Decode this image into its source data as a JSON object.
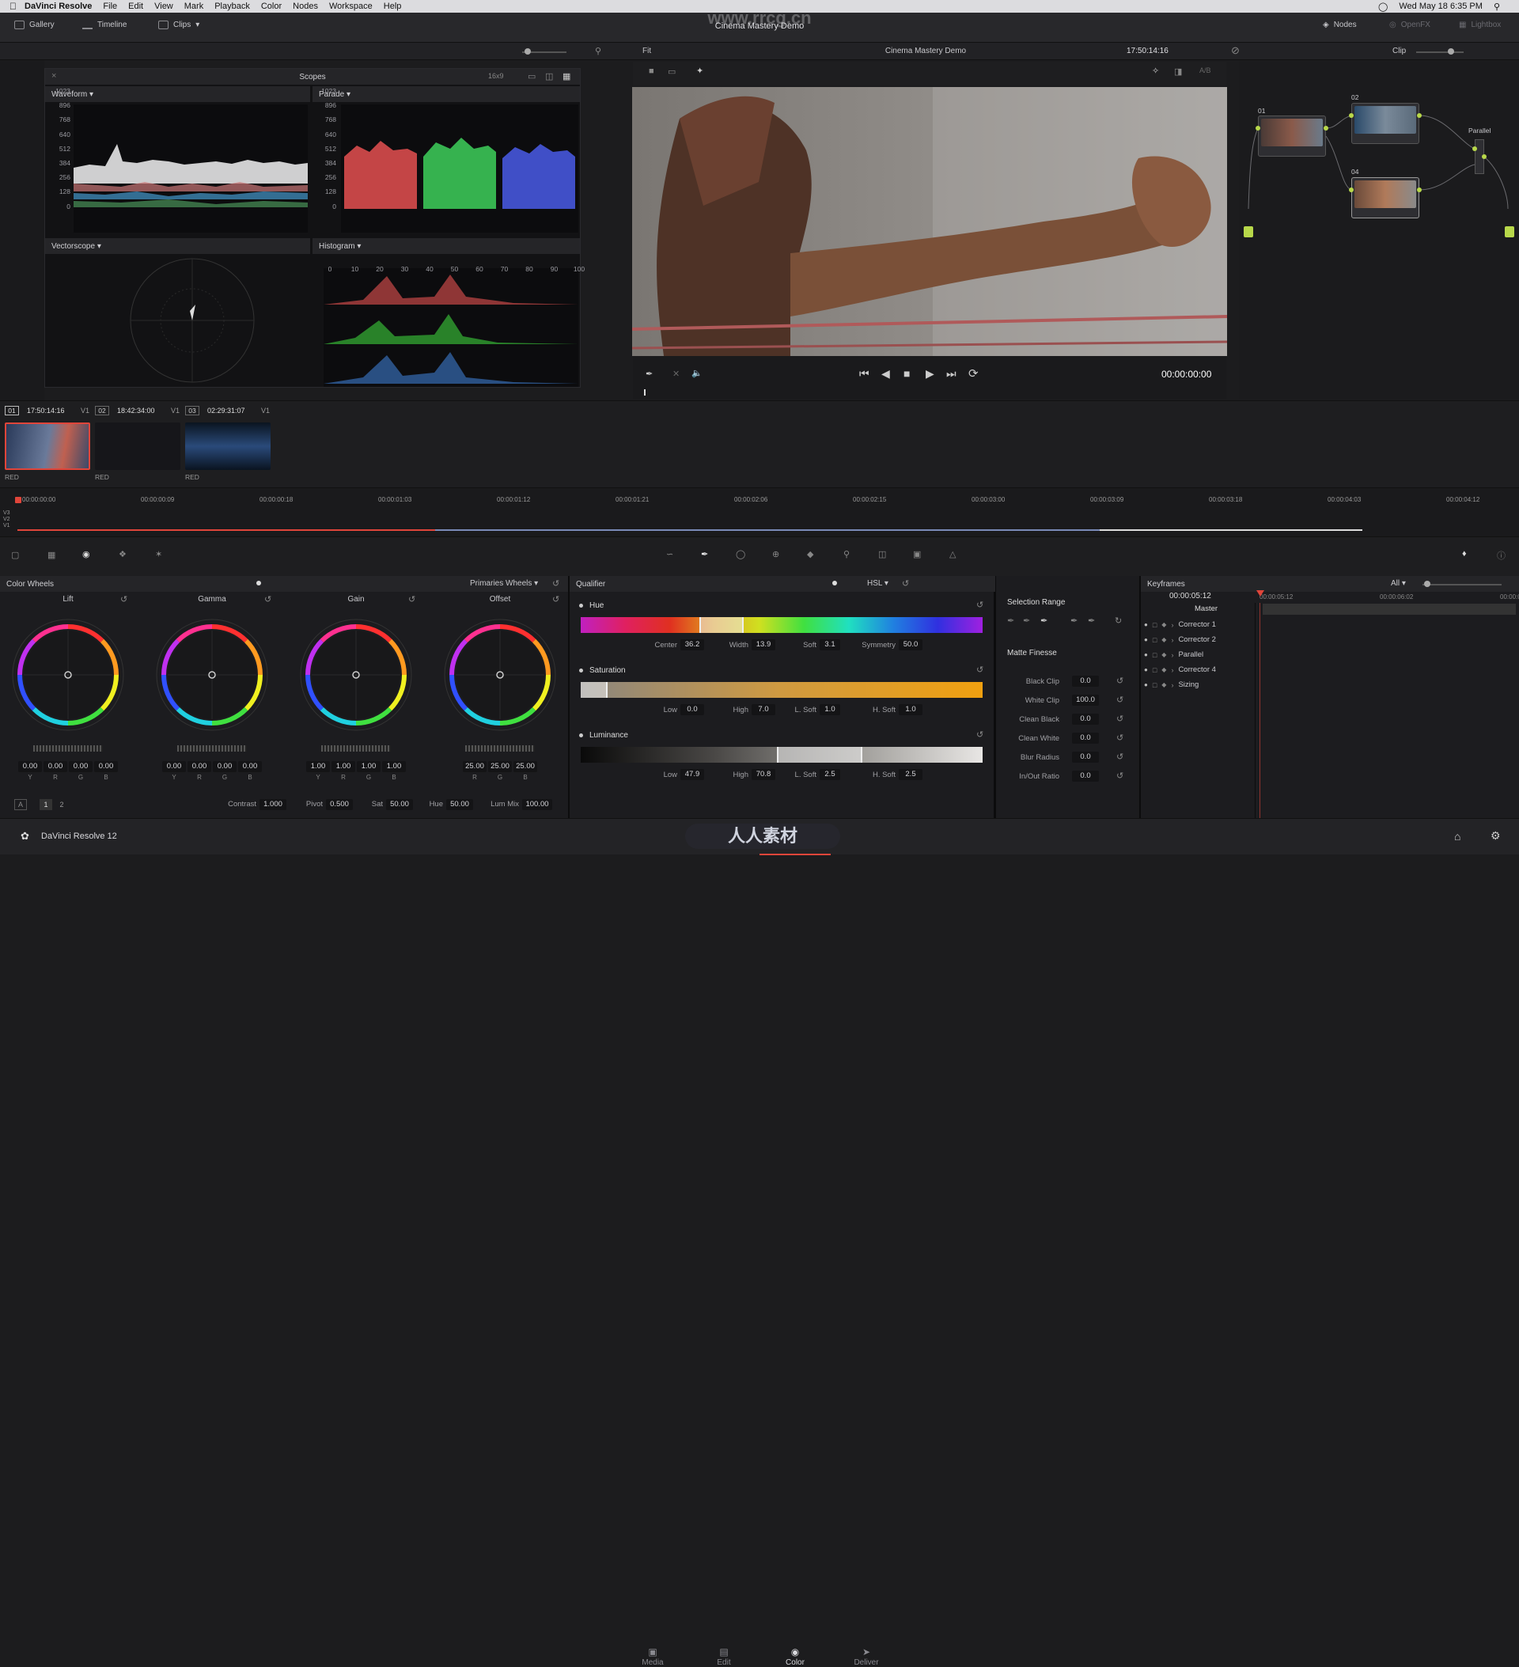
{
  "menubar": {
    "app": "DaVinci Resolve",
    "items": [
      "File",
      "Edit",
      "View",
      "Mark",
      "Playback",
      "Color",
      "Nodes",
      "Workspace",
      "Help"
    ],
    "clock": "Wed May 18  6:35 PM"
  },
  "watermark": "www.rrcg.cn",
  "toolbar": {
    "gallery": "Gallery",
    "timeline": "Timeline",
    "clips": "Clips",
    "project_title": "Cinema Mastery Demo",
    "nodes": "Nodes",
    "openfx": "OpenFX",
    "lightbox": "Lightbox"
  },
  "viewer": {
    "fit": "Fit",
    "title": "Cinema Mastery Demo",
    "timecode": "17:50:14:16",
    "clip_mode": "Clip",
    "ab": "A/B",
    "playhead_tc": "00:00:00:00"
  },
  "scopes": {
    "title": "Scopes",
    "ratio": "16x9",
    "waveform": "Waveform",
    "parade": "Parade",
    "vectorscope": "Vectorscope",
    "histogram": "Histogram",
    "levels": [
      "1023",
      "896",
      "768",
      "640",
      "512",
      "384",
      "256",
      "128",
      "0"
    ],
    "hist_ticks": [
      "0",
      "10",
      "20",
      "30",
      "40",
      "50",
      "60",
      "70",
      "80",
      "90",
      "100"
    ]
  },
  "nodes": {
    "n01": "01",
    "n02": "02",
    "n04": "04",
    "parallel": "Parallel"
  },
  "clips": [
    {
      "num": "01",
      "tc": "17:50:14:16",
      "track": "V1",
      "codec": "RED"
    },
    {
      "num": "02",
      "tc": "18:42:34:00",
      "track": "V1",
      "codec": "RED"
    },
    {
      "num": "03",
      "tc": "02:29:31:07",
      "track": "V1",
      "codec": "RED"
    }
  ],
  "timeline": {
    "ruler": [
      "00:00:00:00",
      "00:00:00:09",
      "00:00:00:18",
      "00:00:01:03",
      "00:00:01:12",
      "00:00:01:21",
      "00:00:02:06",
      "00:00:02:15",
      "00:00:03:00",
      "00:00:03:09",
      "00:00:03:18",
      "00:00:04:03",
      "00:00:04:12"
    ],
    "tracks": [
      "V3",
      "V2",
      "V1"
    ]
  },
  "colorwheels": {
    "title": "Color Wheels",
    "mode": "Primaries Wheels",
    "wheels": [
      {
        "name": "Lift",
        "values": [
          "0.00",
          "0.00",
          "0.00",
          "0.00"
        ],
        "channels": [
          "Y",
          "R",
          "G",
          "B"
        ]
      },
      {
        "name": "Gamma",
        "values": [
          "0.00",
          "0.00",
          "0.00",
          "0.00"
        ],
        "channels": [
          "Y",
          "R",
          "G",
          "B"
        ]
      },
      {
        "name": "Gain",
        "values": [
          "1.00",
          "1.00",
          "1.00",
          "1.00"
        ],
        "channels": [
          "Y",
          "R",
          "G",
          "B"
        ]
      },
      {
        "name": "Offset",
        "values": [
          "25.00",
          "25.00",
          "25.00"
        ],
        "channels": [
          "R",
          "G",
          "B"
        ]
      }
    ],
    "page_a": "A",
    "page1": "1",
    "page2": "2",
    "contrast_label": "Contrast",
    "contrast": "1.000",
    "pivot_label": "Pivot",
    "pivot": "0.500",
    "sat_label": "Sat",
    "sat": "50.00",
    "hue_label": "Hue",
    "hue": "50.00",
    "lummix_label": "Lum Mix",
    "lummix": "100.00"
  },
  "qualifier": {
    "title": "Qualifier",
    "mode": "HSL",
    "hue": {
      "label": "Hue",
      "center_l": "Center",
      "center": "36.2",
      "width_l": "Width",
      "width": "13.9",
      "soft_l": "Soft",
      "soft": "3.1",
      "sym_l": "Symmetry",
      "sym": "50.0"
    },
    "saturation": {
      "label": "Saturation",
      "low_l": "Low",
      "low": "0.0",
      "high_l": "High",
      "high": "7.0",
      "lsoft_l": "L. Soft",
      "lsoft": "1.0",
      "hsoft_l": "H. Soft",
      "hsoft": "1.0"
    },
    "luminance": {
      "label": "Luminance",
      "low_l": "Low",
      "low": "47.9",
      "high_l": "High",
      "high": "70.8",
      "lsoft_l": "L. Soft",
      "lsoft": "2.5",
      "hsoft_l": "H. Soft",
      "hsoft": "2.5"
    },
    "selection_range": "Selection Range",
    "matte_finesse": "Matte Finesse",
    "finesse": [
      {
        "label": "Black Clip",
        "value": "0.0"
      },
      {
        "label": "White Clip",
        "value": "100.0"
      },
      {
        "label": "Clean Black",
        "value": "0.0"
      },
      {
        "label": "Clean White",
        "value": "0.0"
      },
      {
        "label": "Blur Radius",
        "value": "0.0"
      },
      {
        "label": "In/Out Ratio",
        "value": "0.0"
      }
    ]
  },
  "keyframes": {
    "title": "Keyframes",
    "filter": "All",
    "tc": "00:00:05:12",
    "ruler1": "00:00:05:12",
    "ruler2": "00:00:06:02",
    "ruler3": "00:00:0",
    "master": "Master",
    "items": [
      "Corrector 1",
      "Corrector 2",
      "Parallel",
      "Corrector 4",
      "Sizing"
    ]
  },
  "bottom": {
    "app": "DaVinci Resolve 12",
    "tabs": [
      "Media",
      "Edit",
      "Color",
      "Deliver"
    ],
    "logo_text": "人人素材"
  },
  "colors": {
    "accent_red": "#e0453a",
    "node_green": "#b8d84a",
    "active_tab": "#d8d8dc"
  }
}
